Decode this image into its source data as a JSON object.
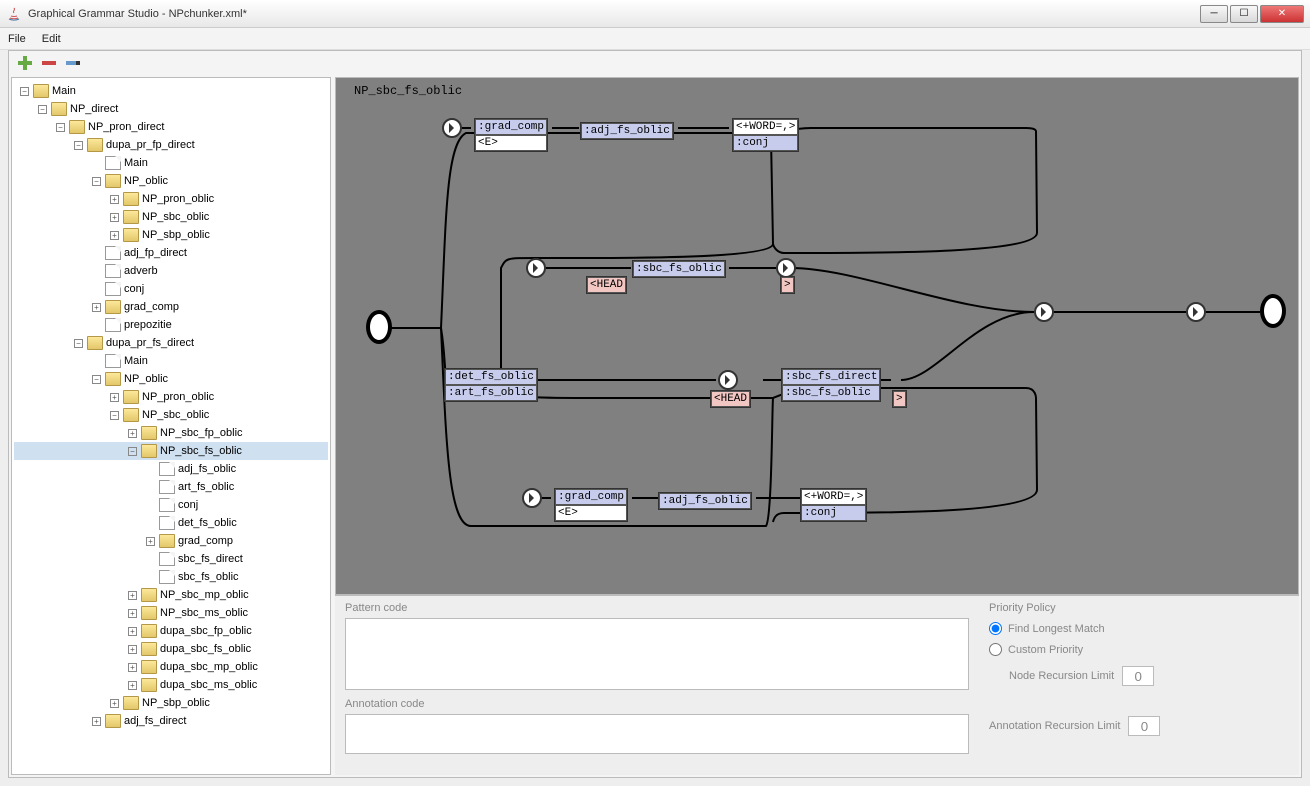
{
  "window": {
    "title": "Graphical Grammar Studio - NPchunker.xml*"
  },
  "menu": {
    "file": "File",
    "edit": "Edit"
  },
  "tree": [
    {
      "d": 0,
      "t": "exp",
      "i": "folder",
      "l": "Main"
    },
    {
      "d": 1,
      "t": "exp",
      "i": "folder",
      "l": "NP_direct"
    },
    {
      "d": 2,
      "t": "exp",
      "i": "folder",
      "l": "NP_pron_direct"
    },
    {
      "d": 3,
      "t": "exp",
      "i": "folder",
      "l": "dupa_pr_fp_direct"
    },
    {
      "d": 4,
      "t": "leaf",
      "i": "file",
      "l": "Main"
    },
    {
      "d": 4,
      "t": "exp",
      "i": "folder",
      "l": "NP_oblic"
    },
    {
      "d": 5,
      "t": "col",
      "i": "folder",
      "l": "NP_pron_oblic"
    },
    {
      "d": 5,
      "t": "col",
      "i": "folder",
      "l": "NP_sbc_oblic"
    },
    {
      "d": 5,
      "t": "col",
      "i": "folder",
      "l": "NP_sbp_oblic"
    },
    {
      "d": 4,
      "t": "leaf",
      "i": "file",
      "l": "adj_fp_direct"
    },
    {
      "d": 4,
      "t": "leaf",
      "i": "file",
      "l": "adverb"
    },
    {
      "d": 4,
      "t": "leaf",
      "i": "file",
      "l": "conj"
    },
    {
      "d": 4,
      "t": "col",
      "i": "folder",
      "l": "grad_comp"
    },
    {
      "d": 4,
      "t": "leaf",
      "i": "file",
      "l": "prepozitie"
    },
    {
      "d": 3,
      "t": "exp",
      "i": "folder",
      "l": "dupa_pr_fs_direct"
    },
    {
      "d": 4,
      "t": "leaf",
      "i": "file",
      "l": "Main"
    },
    {
      "d": 4,
      "t": "exp",
      "i": "folder",
      "l": "NP_oblic"
    },
    {
      "d": 5,
      "t": "col",
      "i": "folder",
      "l": "NP_pron_oblic"
    },
    {
      "d": 5,
      "t": "exp",
      "i": "folder",
      "l": "NP_sbc_oblic"
    },
    {
      "d": 6,
      "t": "col",
      "i": "folder",
      "l": "NP_sbc_fp_oblic"
    },
    {
      "d": 6,
      "t": "exp",
      "i": "folder",
      "l": "NP_sbc_fs_oblic",
      "sel": true
    },
    {
      "d": 7,
      "t": "leaf",
      "i": "file",
      "l": "adj_fs_oblic"
    },
    {
      "d": 7,
      "t": "leaf",
      "i": "file",
      "l": "art_fs_oblic"
    },
    {
      "d": 7,
      "t": "leaf",
      "i": "file",
      "l": "conj"
    },
    {
      "d": 7,
      "t": "leaf",
      "i": "file",
      "l": "det_fs_oblic"
    },
    {
      "d": 7,
      "t": "col",
      "i": "folder",
      "l": "grad_comp"
    },
    {
      "d": 7,
      "t": "leaf",
      "i": "file",
      "l": "sbc_fs_direct"
    },
    {
      "d": 7,
      "t": "leaf",
      "i": "file",
      "l": "sbc_fs_oblic"
    },
    {
      "d": 6,
      "t": "col",
      "i": "folder",
      "l": "NP_sbc_mp_oblic"
    },
    {
      "d": 6,
      "t": "col",
      "i": "folder",
      "l": "NP_sbc_ms_oblic"
    },
    {
      "d": 6,
      "t": "col",
      "i": "folder",
      "l": "dupa_sbc_fp_oblic"
    },
    {
      "d": 6,
      "t": "col",
      "i": "folder",
      "l": "dupa_sbc_fs_oblic"
    },
    {
      "d": 6,
      "t": "col",
      "i": "folder",
      "l": "dupa_sbc_mp_oblic"
    },
    {
      "d": 6,
      "t": "col",
      "i": "folder",
      "l": "dupa_sbc_ms_oblic"
    },
    {
      "d": 5,
      "t": "col",
      "i": "folder",
      "l": "NP_sbp_oblic"
    },
    {
      "d": 4,
      "t": "col",
      "i": "folder",
      "l": "adj_fs_direct"
    }
  ],
  "graph": {
    "title": "NP_sbc_fs_oblic",
    "nodes": {
      "grad1": {
        "lines": [
          {
            "c": "blue",
            "t": ":grad_comp"
          },
          {
            "c": "",
            "t": "<E>"
          }
        ]
      },
      "adj1": {
        "lines": [
          {
            "c": "blue",
            "t": ":adj_fs_oblic"
          }
        ]
      },
      "word1": {
        "lines": [
          {
            "c": "",
            "t": "<+WORD=,>"
          },
          {
            "c": "blue",
            "t": ":conj"
          }
        ]
      },
      "sbc_top": {
        "lines": [
          {
            "c": "blue",
            "t": ":sbc_fs_oblic"
          }
        ]
      },
      "head_top": {
        "lines": [
          {
            "c": "pink",
            "t": "<HEAD"
          }
        ]
      },
      "gt_top": {
        "lines": [
          {
            "c": "pink",
            "t": ">"
          }
        ]
      },
      "det": {
        "lines": [
          {
            "c": "blue",
            "t": ":det_fs_oblic"
          },
          {
            "c": "blue",
            "t": ":art_fs_oblic"
          }
        ]
      },
      "head_mid": {
        "lines": [
          {
            "c": "pink",
            "t": "<HEAD"
          }
        ]
      },
      "sbc_mid": {
        "lines": [
          {
            "c": "blue",
            "t": ":sbc_fs_direct"
          },
          {
            "c": "blue",
            "t": ":sbc_fs_oblic"
          }
        ]
      },
      "gt_mid": {
        "lines": [
          {
            "c": "pink",
            "t": ">"
          }
        ]
      },
      "grad2": {
        "lines": [
          {
            "c": "blue",
            "t": ":grad_comp"
          },
          {
            "c": "",
            "t": "<E>"
          }
        ]
      },
      "adj2": {
        "lines": [
          {
            "c": "blue",
            "t": ":adj_fs_oblic"
          }
        ]
      },
      "word2": {
        "lines": [
          {
            "c": "",
            "t": "<+WORD=,>"
          },
          {
            "c": "blue",
            "t": ":conj"
          }
        ]
      }
    }
  },
  "bottom": {
    "pattern_label": "Pattern code",
    "annotation_label": "Annotation code",
    "priority_label": "Priority Policy",
    "longest": "Find Longest Match",
    "custom": "Custom Priority",
    "node_limit_label": "Node Recursion Limit",
    "anno_limit_label": "Annotation Recursion Limit",
    "node_limit": "0",
    "anno_limit": "0"
  }
}
